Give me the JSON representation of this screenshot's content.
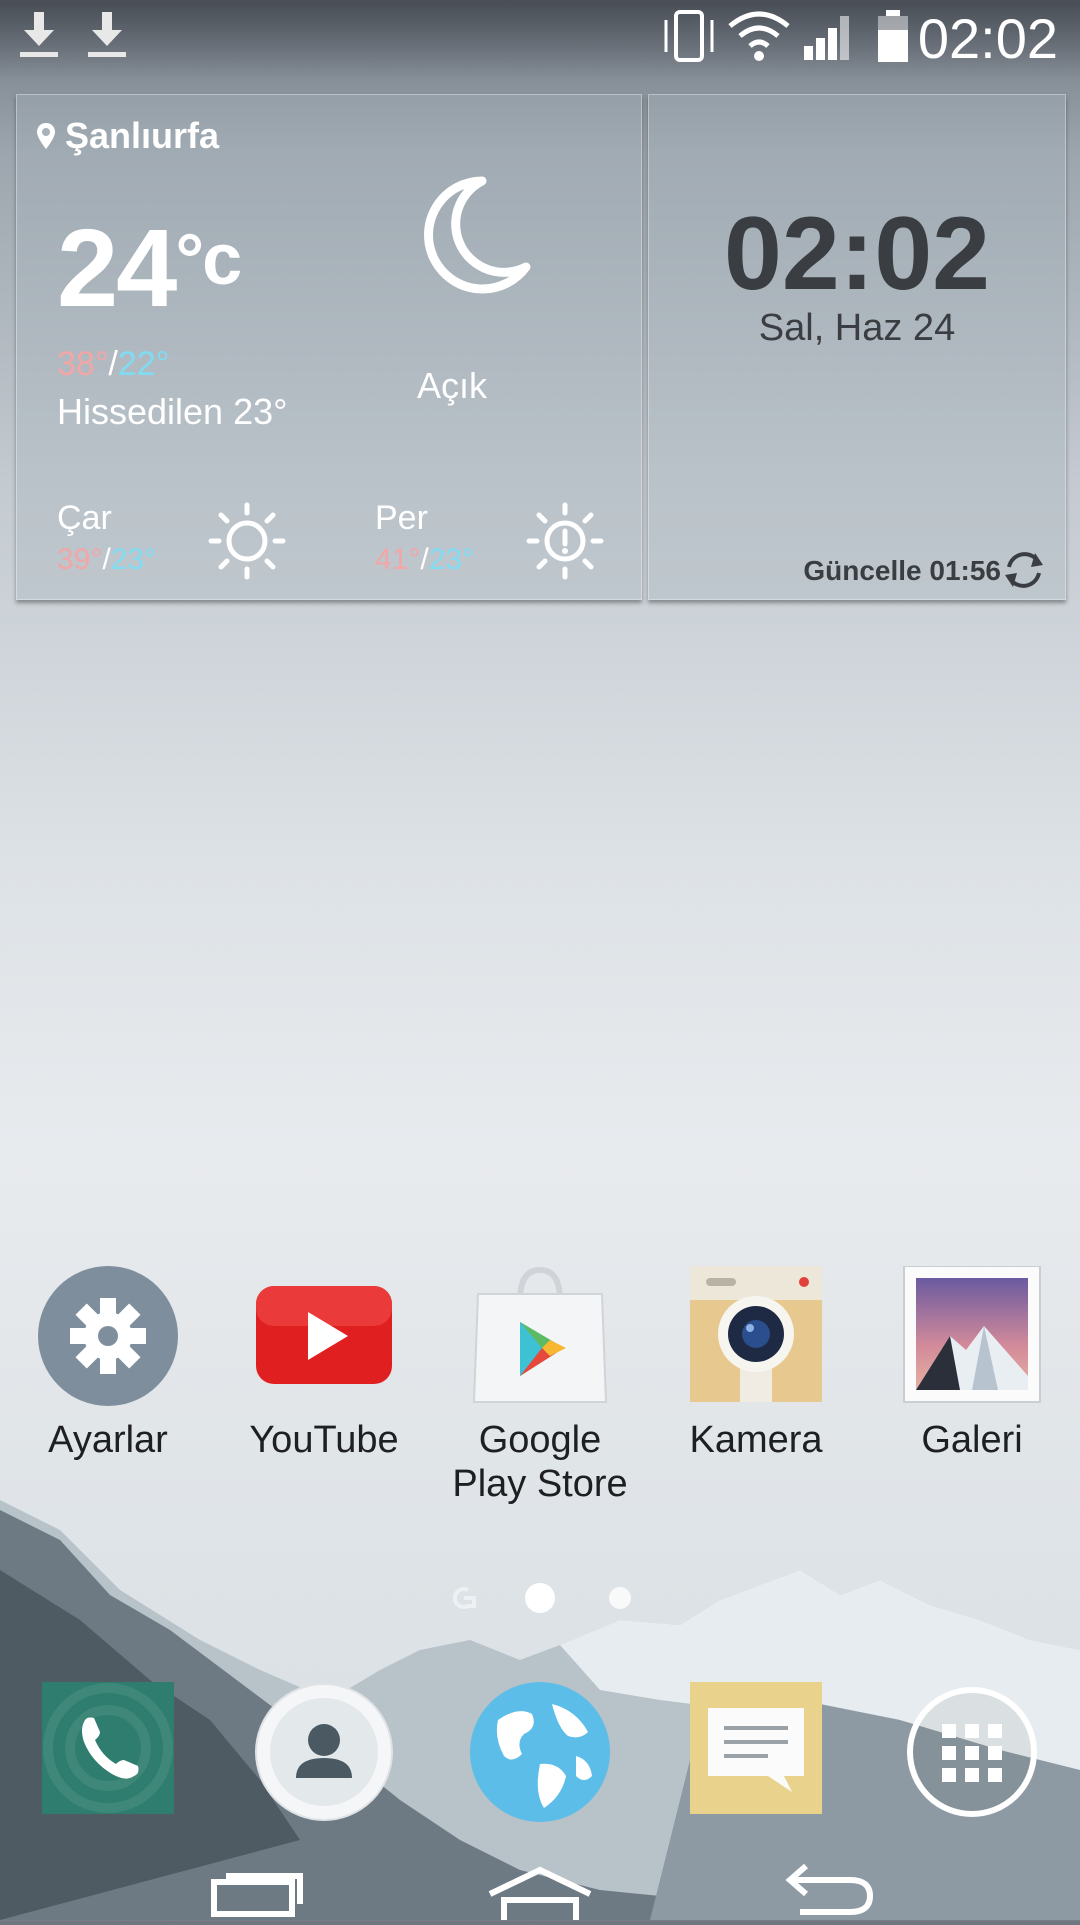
{
  "status_bar": {
    "time": "02:02",
    "icons": [
      "download-icon",
      "download-icon",
      "vibrate-icon",
      "wifi-icon",
      "signal-icon",
      "battery-icon"
    ]
  },
  "weather_widget": {
    "location": "Şanlıurfa",
    "temperature": "24",
    "unit": "°c",
    "high": "38°",
    "low": "22°",
    "feels_like": "Hissedilen 23°",
    "condition": "Açık",
    "forecast": [
      {
        "day": "Çar",
        "high": "39°",
        "low": "23°",
        "icon": "sun-icon"
      },
      {
        "day": "Per",
        "high": "41°",
        "low": "23°",
        "icon": "sun-alert-icon"
      }
    ]
  },
  "clock_widget": {
    "time": "02:02",
    "date": "Sal, Haz 24",
    "update_label": "Güncelle 01:56"
  },
  "apps": [
    {
      "label": "Ayarlar",
      "icon": "settings-icon"
    },
    {
      "label": "YouTube",
      "icon": "youtube-icon"
    },
    {
      "label": "Google Play Store",
      "icon": "play-store-icon"
    },
    {
      "label": "Kamera",
      "icon": "camera-icon"
    },
    {
      "label": "Galeri",
      "icon": "gallery-icon"
    }
  ],
  "page_indicator": {
    "pages": 3,
    "current": 2
  },
  "dock": [
    "phone-icon",
    "contacts-icon",
    "browser-icon",
    "messages-icon",
    "app-drawer-icon"
  ],
  "nav_bar": [
    "recents-icon",
    "home-icon",
    "back-icon"
  ],
  "colors": {
    "high_temp": "#f2a6a6",
    "low_temp": "#7fdcf2",
    "youtube_red": "#e02020"
  }
}
